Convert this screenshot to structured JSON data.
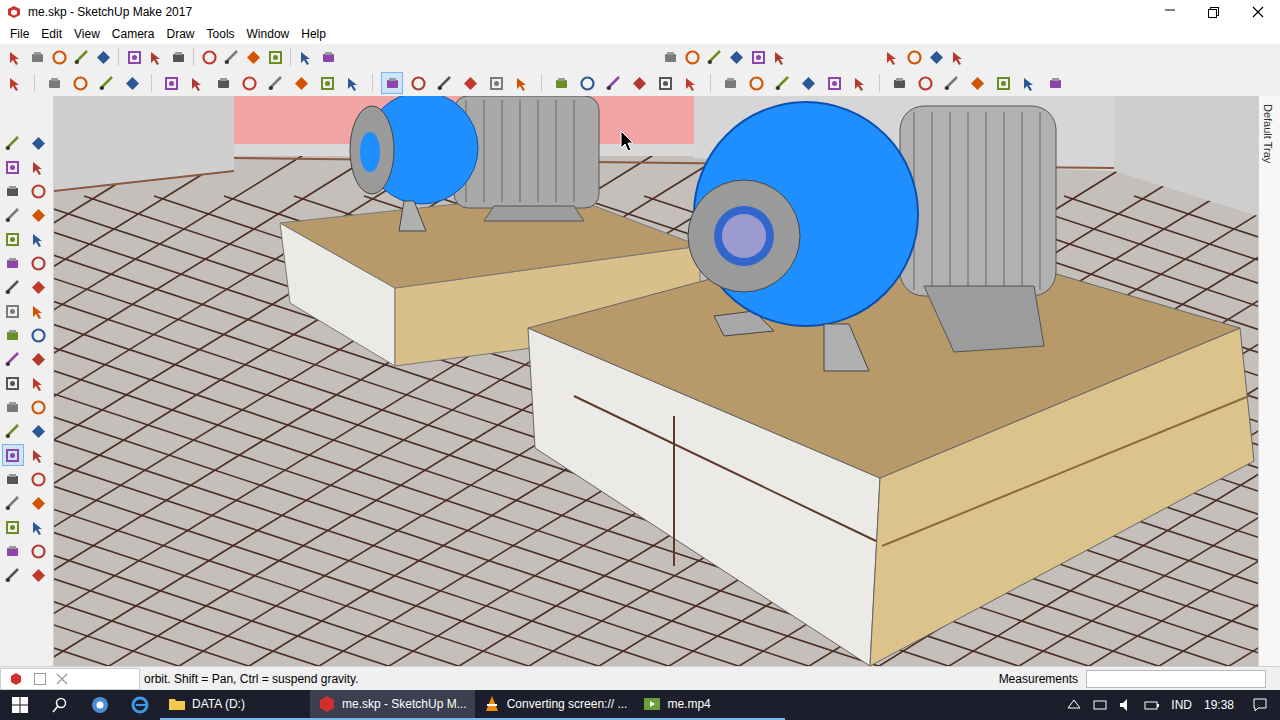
{
  "window": {
    "title": "me.skp - SketchUp Make 2017"
  },
  "menu": [
    "File",
    "Edit",
    "View",
    "Camera",
    "Draw",
    "Tools",
    "Window",
    "Help"
  ],
  "toolbars": {
    "standard": [
      {
        "selected": false
      },
      {
        "selected": false
      },
      {
        "selected": false
      },
      {
        "selected": false
      },
      {
        "selected": false
      },
      {
        "selected": false
      },
      {
        "selected": false
      },
      {
        "selected": false
      },
      {
        "selected": false
      },
      {
        "selected": false
      },
      {
        "selected": false
      },
      {
        "selected": false
      },
      {
        "selected": false
      },
      {
        "selected": false
      }
    ],
    "views": [
      {
        "selected": false
      },
      {
        "selected": false
      },
      {
        "selected": false
      },
      {
        "selected": false
      },
      {
        "selected": false
      },
      {
        "selected": false
      }
    ],
    "warehouse": [
      {
        "selected": false
      },
      {
        "selected": false
      },
      {
        "selected": false
      },
      {
        "selected": false
      }
    ],
    "main": [
      {
        "selected": false
      },
      {
        "selected": false
      },
      {
        "selected": false
      },
      {
        "selected": false
      },
      {
        "selected": false
      },
      {
        "selected": false
      },
      {
        "selected": false
      },
      {
        "selected": false
      },
      {
        "selected": false
      },
      {
        "selected": false
      },
      {
        "selected": false
      },
      {
        "selected": false
      },
      {
        "selected": false
      },
      {
        "selected": true
      },
      {
        "selected": false
      },
      {
        "selected": false
      },
      {
        "selected": false
      },
      {
        "selected": false
      },
      {
        "selected": false
      },
      {
        "selected": false
      },
      {
        "selected": false
      },
      {
        "selected": false
      },
      {
        "selected": false
      },
      {
        "selected": false
      },
      {
        "selected": false
      },
      {
        "selected": false
      },
      {
        "selected": false
      },
      {
        "selected": false
      },
      {
        "selected": false
      },
      {
        "selected": false
      },
      {
        "selected": false
      },
      {
        "selected": false
      },
      {
        "selected": false
      },
      {
        "selected": false
      },
      {
        "selected": false
      },
      {
        "selected": false
      },
      {
        "selected": false
      },
      {
        "selected": false
      }
    ],
    "left": [
      {
        "selected": false
      },
      {
        "selected": false
      },
      {
        "selected": false
      },
      {
        "selected": false
      },
      {
        "selected": false
      },
      {
        "selected": false
      },
      {
        "selected": false
      },
      {
        "selected": false
      },
      {
        "selected": false
      },
      {
        "selected": false
      },
      {
        "selected": false
      },
      {
        "selected": false
      },
      {
        "selected": false
      },
      {
        "selected": false
      },
      {
        "selected": false
      },
      {
        "selected": false
      },
      {
        "selected": false
      },
      {
        "selected": false
      },
      {
        "selected": false
      },
      {
        "selected": false
      },
      {
        "selected": false
      },
      {
        "selected": false
      },
      {
        "selected": false
      },
      {
        "selected": false
      },
      {
        "selected": false
      },
      {
        "selected": false
      },
      {
        "selected": true
      },
      {
        "selected": false
      },
      {
        "selected": false
      },
      {
        "selected": false
      },
      {
        "selected": false
      },
      {
        "selected": false
      },
      {
        "selected": false
      },
      {
        "selected": false
      },
      {
        "selected": false
      },
      {
        "selected": false
      },
      {
        "selected": false
      },
      {
        "selected": false
      }
    ]
  },
  "tray": {
    "label": "Default Tray"
  },
  "status_bar": {
    "hint": "orbit. Shift = Pan, Ctrl = suspend gravity.",
    "measurements_label": "Measurements"
  },
  "taskbar": {
    "items": [
      {
        "label": "DATA (D:)",
        "selected": false
      },
      {
        "label": "me.skp - SketchUp M...",
        "selected": true
      },
      {
        "label": "Converting screen:// ...",
        "selected": false
      },
      {
        "label": "me.mp4",
        "selected": false
      }
    ],
    "language": "IND",
    "time": "19:38"
  }
}
